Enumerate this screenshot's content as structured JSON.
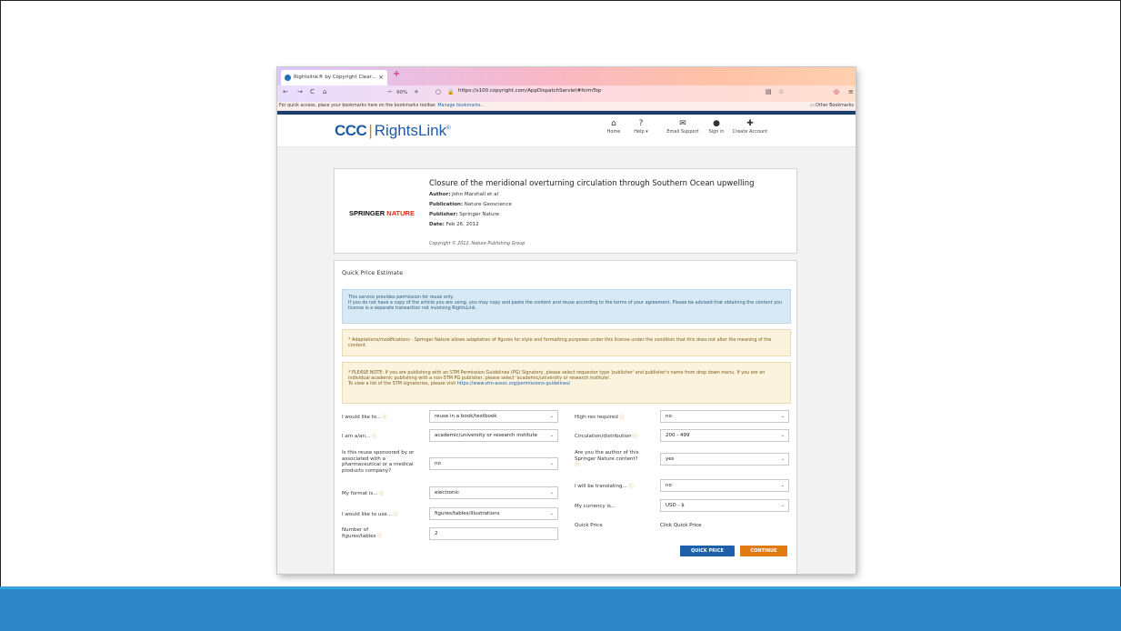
{
  "browser": {
    "tab_title": "Rightslink® by Copyright Clear...",
    "tab_close": "×",
    "new_tab": "+",
    "zoom": "90%",
    "url": "https://s100.copyright.com/AppDispatchServlet#formTop",
    "bookmarks_text": "For quick access, place your bookmarks here on the bookmarks toolbar.",
    "manage_bookmarks": "Manage bookmarks...",
    "other_bookmarks": "Other Bookmarks"
  },
  "header": {
    "logo_ccc": "CCC",
    "logo_sep": "|",
    "logo_name": "RightsLink",
    "logo_reg": "®",
    "nav": [
      {
        "label": "Home",
        "glyph": "⌂"
      },
      {
        "label": "Help ▾",
        "glyph": "?"
      },
      {
        "label": "Email Support",
        "glyph": "✉"
      },
      {
        "label": "Sign in",
        "glyph": "●"
      },
      {
        "label": "Create Account",
        "glyph": "✚"
      }
    ]
  },
  "article": {
    "publisher_logo_1": "SPRINGER",
    "publisher_logo_2": "NATURE",
    "title": "Closure of the meridional overturning circulation through Southern Ocean upwelling",
    "author_label": "Author:",
    "author": "John Marshall et al",
    "publication_label": "Publication:",
    "publication": "Nature Geoscience",
    "publisher_label": "Publisher:",
    "publisher": "Springer Nature",
    "date_label": "Date:",
    "date": "Feb 26, 2012",
    "copyright": "Copyright © 2012, Nature Publishing Group"
  },
  "quick_price": {
    "title": "Quick Price Estimate",
    "notice_blue": "This service provides permission for reuse only.\nIf you do not have a copy of the article you are using, you may copy and paste the content and reuse according to the terms of your agreement. Please be advised that obtaining the content you license is a separate transaction not involving RightsLink.",
    "notice_adapt": "Adaptations/modifications - Springer Nature allows adaptation of figures for style and formatting purposes under this license under the condition that this does not alter the meaning of the content.",
    "notice_stm": "PLEASE NOTE: If you are publishing with an STM Permission Guidelines (PG) Signatory, please select requestor type 'publisher' and publisher's name from drop down menu. If you are an individual academic publishing with a non-STM PG publisher, please select 'academic/university or research institute'.",
    "notice_stm_link_prefix": "To view a list of the STM signatories, please visit",
    "notice_stm_link": "https://www.stm-assoc.org/permissions-guidelines/",
    "fields": {
      "would_like_to": {
        "label": "I would like to...",
        "value": "reuse in a book/textbook"
      },
      "i_am": {
        "label": "I am a/an...",
        "value": "academic/university or research institute"
      },
      "sponsored": {
        "label": "Is this reuse sponsored by or associated with a pharmaceutical or a medical products company?",
        "value": "no"
      },
      "format": {
        "label": "My format is...",
        "value": "electronic"
      },
      "use": {
        "label": "I would like to use...",
        "value": "figures/tables/illustrations"
      },
      "number": {
        "label": "Number of figures/tables",
        "value": "2"
      },
      "high_res": {
        "label": "High-res required",
        "value": "no"
      },
      "circulation": {
        "label": "Circulation/distribution",
        "value": "200 - 499"
      },
      "author": {
        "label": "Are you the author of this Springer Nature content?",
        "value": "yes"
      },
      "translating": {
        "label": "I will be translating...",
        "value": "no"
      },
      "currency": {
        "label": "My currency is...",
        "value": "USD - $"
      },
      "quick_price": {
        "label": "Quick Price",
        "value": "Click Quick Price"
      }
    },
    "buttons": {
      "quick_price": "QUICK PRICE",
      "continue": "CONTINUE"
    }
  },
  "colors": {
    "footer_bar": "#2c86c7",
    "ccc_blue": "#1e5aa8",
    "accent_orange": "#e07b12"
  }
}
